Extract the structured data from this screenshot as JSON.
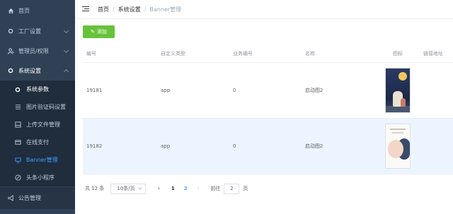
{
  "sidebar": {
    "items": [
      {
        "label": "首页",
        "icon": "home-icon"
      },
      {
        "label": "工厂设置",
        "icon": "dot-icon"
      },
      {
        "label": "管理员/权限",
        "icon": "user-icon"
      },
      {
        "label": "系统设置",
        "icon": "dot-icon"
      }
    ],
    "submenu": [
      {
        "label": "系统参数",
        "icon": "dot-icon"
      },
      {
        "label": "图片验证码设置",
        "icon": "list-icon"
      },
      {
        "label": "上传文件管理",
        "icon": "upload-icon"
      },
      {
        "label": "在线支付",
        "icon": "wallet-icon"
      },
      {
        "label": "Banner管理",
        "icon": "monitor-icon"
      },
      {
        "label": "头条小程序",
        "icon": "compass-icon"
      }
    ],
    "bottom": {
      "label": "公告管理",
      "icon": "announce-icon"
    }
  },
  "header": {
    "breadcrumb": [
      "首页",
      "系统设置",
      "Banner管理"
    ]
  },
  "toolbar": {
    "add_label": "添加"
  },
  "table": {
    "columns": [
      "编号",
      "自定义类型",
      "业务编号",
      "名称",
      "图标",
      "链接地址"
    ],
    "rows": [
      {
        "id": "19181",
        "type": "app",
        "biz": "0",
        "name": "启动图2",
        "link": ""
      },
      {
        "id": "19182",
        "type": "app",
        "biz": "0",
        "name": "启动图2",
        "link": ""
      }
    ]
  },
  "pagination": {
    "total": "共 12 条",
    "page_size": "10条/页",
    "prev": "‹",
    "next": "›",
    "pages": [
      "1",
      "2"
    ],
    "current": "2",
    "goto_label": "前往",
    "goto_value": "2",
    "goto_suffix": "页"
  },
  "colors": {
    "sidebar_bg": "#304156",
    "accent": "#409eff",
    "add_button": "#67c23a"
  }
}
